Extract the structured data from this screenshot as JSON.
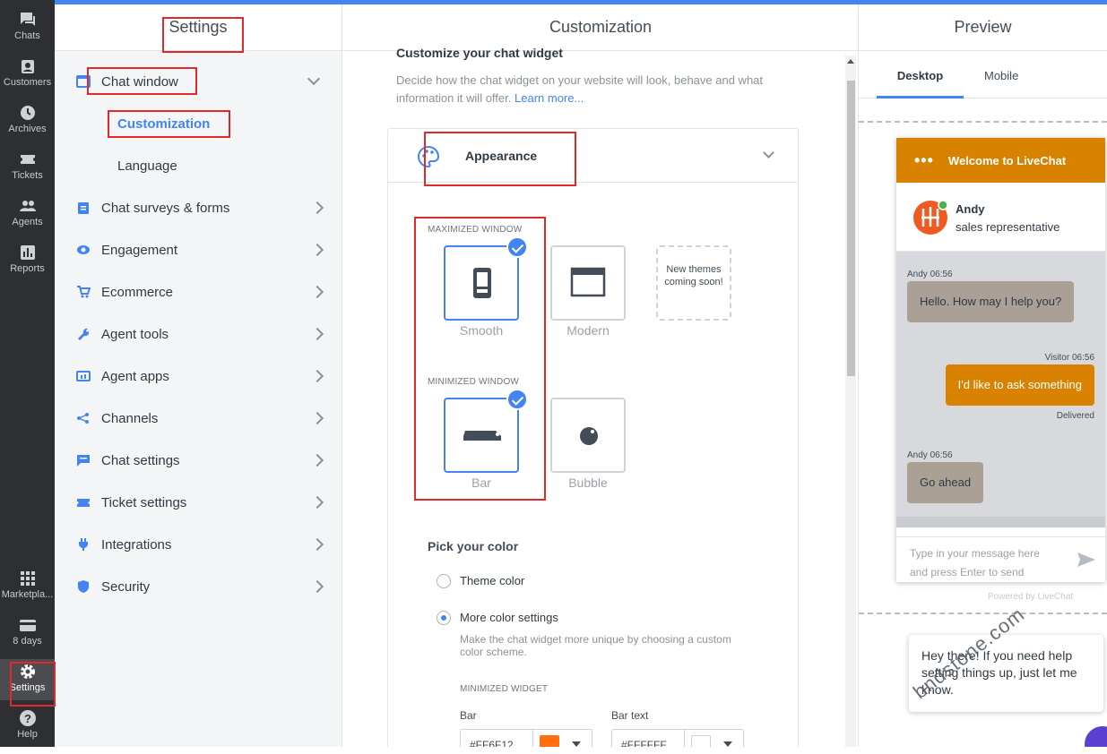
{
  "nav": {
    "items": [
      {
        "label": "Chats",
        "icon": "chat-icon"
      },
      {
        "label": "Customers",
        "icon": "customers-icon"
      },
      {
        "label": "Archives",
        "icon": "clock-icon"
      },
      {
        "label": "Tickets",
        "icon": "ticket-icon"
      },
      {
        "label": "Agents",
        "icon": "agents-icon"
      },
      {
        "label": "Reports",
        "icon": "reports-icon"
      }
    ],
    "bottom": [
      {
        "label": "Marketpla...",
        "icon": "grid-icon"
      },
      {
        "label": "8 days",
        "icon": "card-icon"
      },
      {
        "label": "Settings",
        "icon": "gear-icon"
      },
      {
        "label": "Help",
        "icon": "help-icon"
      }
    ]
  },
  "settings": {
    "title": "Settings",
    "chat_window": "Chat window",
    "sub_customization": "Customization",
    "sub_language": "Language",
    "items": [
      "Chat surveys & forms",
      "Engagement",
      "Ecommerce",
      "Agent tools",
      "Agent apps",
      "Channels",
      "Chat settings",
      "Ticket settings",
      "Integrations",
      "Security"
    ]
  },
  "customization": {
    "title": "Customization",
    "heading": "Customize your chat widget",
    "desc": "Decide how the chat widget on your website will look, behave and what information it will offer.",
    "learn_more": "Learn more...",
    "appearance": "Appearance",
    "maximized_label": "MAXIMIZED WINDOW",
    "minimized_label": "MINIMIZED WINDOW",
    "tile_smooth": "Smooth",
    "tile_modern": "Modern",
    "tile_new": "New themes coming soon!",
    "tile_bar": "Bar",
    "tile_bubble": "Bubble",
    "pick_color": "Pick your color",
    "theme_color": "Theme color",
    "more_color": "More color settings",
    "more_color_desc": "Make the chat widget more unique by choosing a custom color scheme.",
    "minimized_widget": "MINIMIZED WIDGET",
    "bar_label": "Bar",
    "bar_text_label": "Bar text",
    "bar_value": "#FF6F12",
    "bar_text_value": "#FFFFFF",
    "bar_color": "#ff6f12",
    "bar_text_color": "#ffffff"
  },
  "preview": {
    "title": "Preview",
    "tab_desktop": "Desktop",
    "tab_mobile": "Mobile",
    "widget_title": "Welcome to LiveChat",
    "agent_name": "Andy",
    "agent_role": "sales representative",
    "m1_meta": "Andy 06:56",
    "m1": "Hello. How may I help you?",
    "m2_meta": "Visitor 06:56",
    "m2": "I'd like to ask something",
    "m2_status": "Delivered",
    "m3_meta": "Andy 06:56",
    "m3": "Go ahead",
    "input_placeholder": "Type in your message here and press Enter to send",
    "powered": "Powered by LiveChat",
    "tooltip": "Hey there! If you need help setting things up, just let me know.",
    "accent": "#d98200"
  },
  "watermark": "bndstone.com"
}
